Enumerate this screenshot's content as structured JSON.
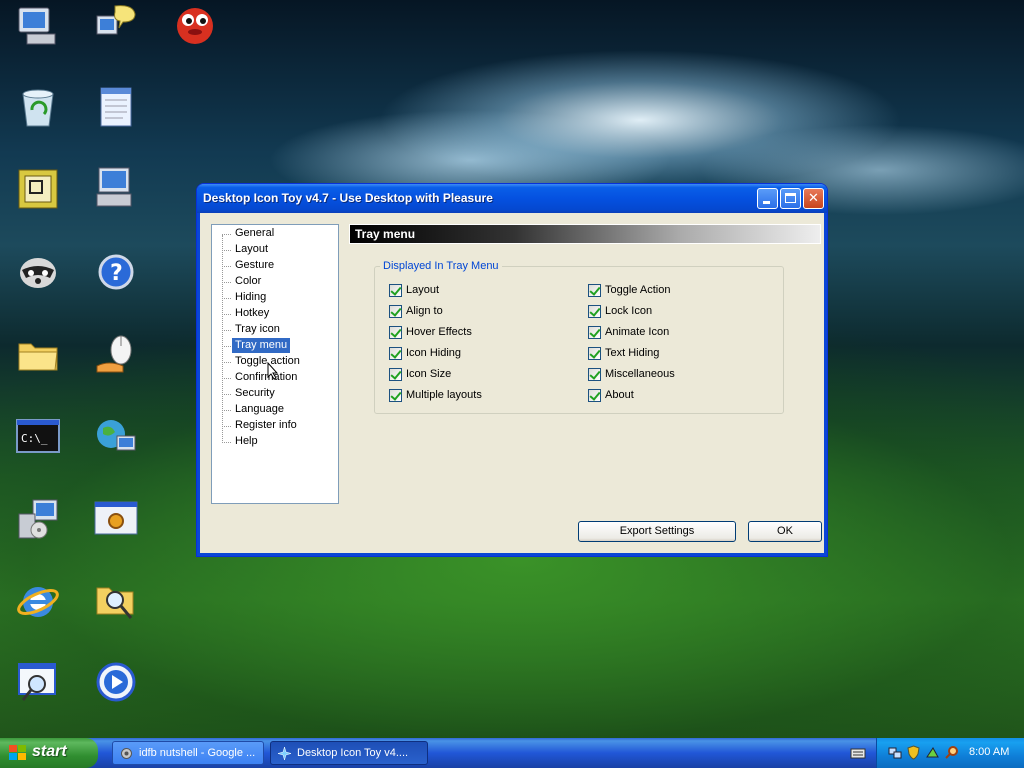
{
  "desktop": {
    "icons": [
      {
        "name": "my-computer-icon"
      },
      {
        "name": "messenger-icon"
      },
      {
        "name": "mascot-icon"
      },
      {
        "name": "recycle-bin-icon"
      },
      {
        "name": "notepad-icon"
      },
      {
        "name": "outlook-icon"
      },
      {
        "name": "onscreen-keyboard-icon"
      },
      {
        "name": "raccoon-icon"
      },
      {
        "name": "help-icon"
      },
      {
        "name": "folder-icon"
      },
      {
        "name": "mouse-icon"
      },
      {
        "name": "command-prompt-icon"
      },
      {
        "name": "network-globe-icon"
      },
      {
        "name": "installer-icon"
      },
      {
        "name": "control-panel-icon"
      },
      {
        "name": "internet-explorer-icon"
      },
      {
        "name": "search-folder-icon"
      },
      {
        "name": "magnifier-window-icon"
      },
      {
        "name": "media-player-icon"
      }
    ]
  },
  "window": {
    "title": "Desktop Icon Toy v4.7 - Use Desktop with Pleasure",
    "tree": {
      "items": [
        "General",
        "Layout",
        "Gesture",
        "Color",
        "Hiding",
        "Hotkey",
        "Tray icon",
        "Tray menu",
        "Toggle action",
        "Confirmation",
        "Security",
        "Language",
        "Register info",
        "Help"
      ],
      "selected": "Tray menu"
    },
    "panel_title": "Tray menu",
    "group_label": "Displayed In Tray Menu",
    "left_options": [
      "Layout",
      "Align to",
      "Hover Effects",
      "Icon Hiding",
      "Icon Size",
      "Multiple layouts"
    ],
    "right_options": [
      "Toggle Action",
      "Lock Icon",
      "Animate Icon",
      "Text Hiding",
      "Miscellaneous",
      "About"
    ],
    "export_button": "Export Settings",
    "ok_button": "OK"
  },
  "taskbar": {
    "start_label": "start",
    "tasks": [
      "idfb nutshell - Google ...",
      "Desktop Icon Toy v4...."
    ],
    "active_task": "Desktop Icon Toy v4....",
    "clock": "8:00 AM"
  },
  "colors": {
    "title_bar": "#0551e0",
    "selection": "#316ac5",
    "group_label": "#0046d5",
    "check": "#21a121"
  }
}
